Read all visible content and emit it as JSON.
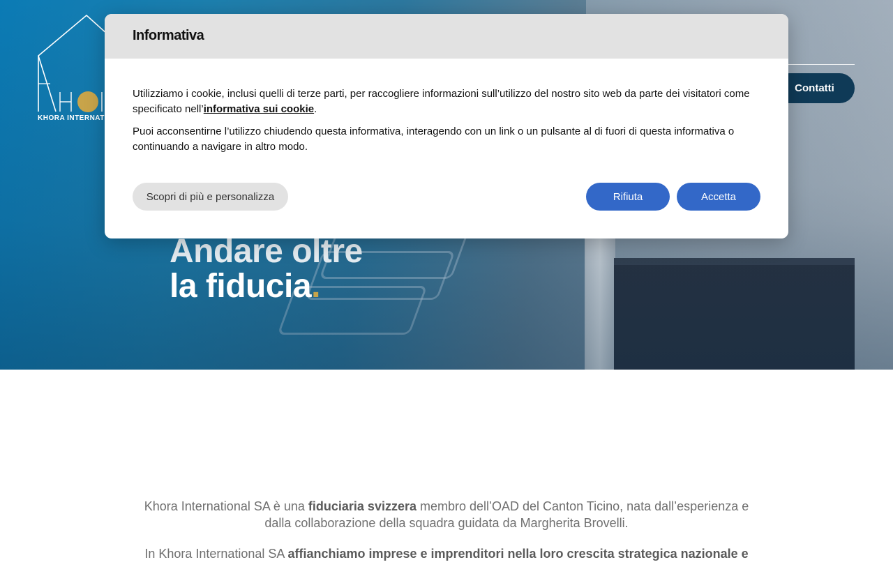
{
  "site": {
    "logo_text": "KHORA INTERNATIONAL",
    "contact_label": "Contatti",
    "brand_colors": {
      "hero_blue": "#0b7bb5",
      "gold": "#c8a44a",
      "nav_dark": "#0f3a57"
    }
  },
  "hero": {
    "headline_line1": "Andare oltre",
    "headline_line2": "la fiducia",
    "headline_dot": "."
  },
  "intro": {
    "p1_part1": "Khora International SA è una ",
    "p1_bold": "fiduciaria svizzera",
    "p1_part2": " membro dell’OAD del Canton Ticino, nata dall’esperienza e dalla collaborazione della squadra guidata da Margherita Brovelli.",
    "p2_part1": "In Khora International SA ",
    "p2_bold": "affianchiamo imprese e imprenditori nella loro crescita strategica nazionale e"
  },
  "cookie_modal": {
    "title": "Informativa",
    "text1_part1": "Utilizziamo i cookie, inclusi quelli di terze parti, per raccogliere informazioni sull’utilizzo del nostro sito web da parte dei visitatori come specificato nell’",
    "text1_link": "informativa sui cookie",
    "text1_part2": ".",
    "text2": "Puoi acconsentirne l’utilizzo chiudendo questa informativa, interagendo con un link o un pulsante al di fuori di questa informativa o continuando a navigare in altro modo.",
    "more_button": "Scopri di più e personalizza",
    "reject_button": "Rifiuta",
    "accept_button": "Accetta",
    "accent_color": "#3368c8"
  }
}
